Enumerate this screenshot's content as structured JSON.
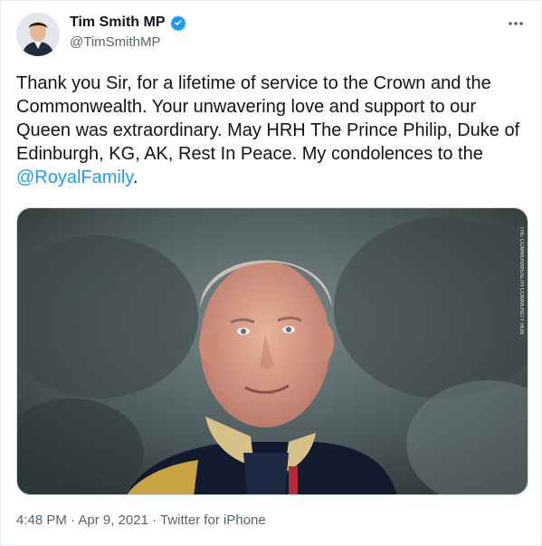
{
  "author": {
    "name": "Tim Smith MP",
    "handle": "@TimSmithMP",
    "verified": true
  },
  "tweet": {
    "text_before_mention": "Thank you Sir, for a lifetime of service to the Crown and the Commonwealth. Your unwavering love and support to our Queen was extraordinary. May HRH The Prince Philip, Duke of Edinburgh, KG, AK, Rest In Peace. My condolences to the ",
    "mention": "@RoyalFamily",
    "text_after_mention": "."
  },
  "media": {
    "watermark": "THE COMMONWEALTH COMMUNITY HUB"
  },
  "meta": {
    "time": "4:48 PM",
    "separator1": " · ",
    "date": "Apr 9, 2021",
    "separator2": " · ",
    "source": "Twitter for iPhone"
  },
  "colors": {
    "link": "#1d9bf0",
    "secondary_text": "#536471",
    "verified_badge": "#1d9bf0"
  },
  "icons": {
    "more": "more-dots-icon",
    "verified": "verified-badge-icon"
  }
}
